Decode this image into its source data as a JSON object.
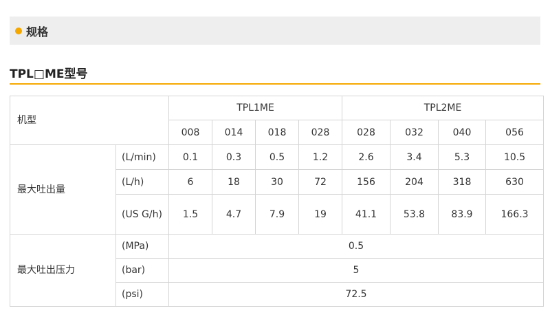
{
  "section": {
    "title": "规格",
    "bullet_color": "#f5a800"
  },
  "model": {
    "title": "TPL□ME型号",
    "underline_color": "#f5a800"
  },
  "table": {
    "model_label": "机型",
    "groups": [
      "TPL1ME",
      "TPL2ME"
    ],
    "models": [
      "008",
      "014",
      "018",
      "028",
      "028",
      "032",
      "040",
      "056"
    ],
    "discharge_label": "最大吐出量",
    "discharge_rows": [
      {
        "unit": "(L/min)",
        "values": [
          "0.1",
          "0.3",
          "0.5",
          "1.2",
          "2.6",
          "3.4",
          "5.3",
          "10.5"
        ]
      },
      {
        "unit": "(L/h)",
        "values": [
          "6",
          "18",
          "30",
          "72",
          "156",
          "204",
          "318",
          "630"
        ]
      },
      {
        "unit": "(US G/h)",
        "values": [
          "1.5",
          "4.7",
          "7.9",
          "19",
          "41.1",
          "53.8",
          "83.9",
          "166.3"
        ]
      }
    ],
    "pressure_label": "最大吐出压力",
    "pressure_rows": [
      {
        "unit": "(MPa)",
        "value": "0.5"
      },
      {
        "unit": "(bar)",
        "value": "5"
      },
      {
        "unit": "(psi)",
        "value": "72.5"
      }
    ]
  }
}
